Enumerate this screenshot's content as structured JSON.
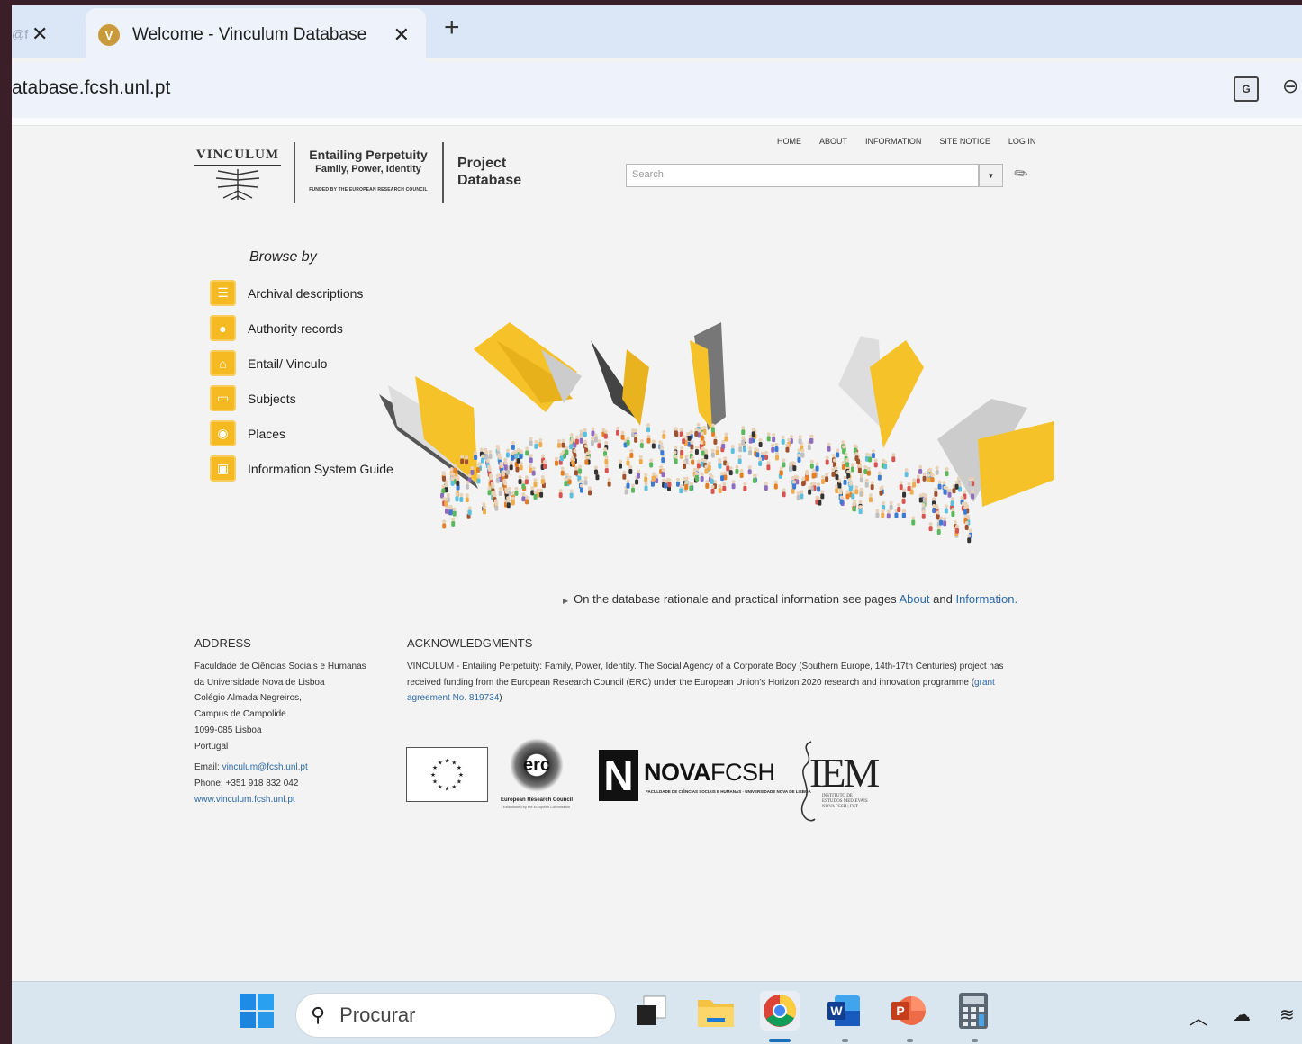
{
  "browser": {
    "prev_tab_fragment": "@f",
    "active_tab_title": "Welcome - Vinculum Database",
    "url": "atabase.fcsh.unl.pt"
  },
  "header": {
    "logo": {
      "vinculum": "VINCULUM",
      "entailing_line1": "Entailing Perpetuity",
      "entailing_line2": "Family, Power, Identity",
      "funded": "FUNDED BY THE EUROPEAN RESEARCH COUNCIL",
      "project_line1": "Project",
      "project_line2": "Database"
    },
    "nav": [
      "HOME",
      "ABOUT",
      "INFORMATION",
      "SITE NOTICE",
      "LOG IN"
    ],
    "search_placeholder": "Search"
  },
  "browse": {
    "title": "Browse by",
    "items": [
      {
        "label": "Archival descriptions",
        "icon": "document-icon"
      },
      {
        "label": "Authority records",
        "icon": "person-icon"
      },
      {
        "label": "Entail/ Vinculo",
        "icon": "building-icon"
      },
      {
        "label": "Subjects",
        "icon": "tag-icon"
      },
      {
        "label": "Places",
        "icon": "map-pin-icon"
      },
      {
        "label": "Information System Guide",
        "icon": "monitor-icon"
      }
    ]
  },
  "info": {
    "text": "On the database rationale and practical information see pages",
    "link_about": "About",
    "and": "and",
    "link_information": "Information."
  },
  "address": {
    "heading": "ADDRESS",
    "lines": [
      "Faculdade de Ciências Sociais e Humanas",
      "da Universidade Nova de Lisboa",
      "Colégio Almada Negreiros,",
      "Campus de Campolide",
      "1099-085 Lisboa",
      "Portugal"
    ],
    "email_label": "Email:",
    "email": "vinculum@fcsh.unl.pt",
    "phone": "Phone: +351 918 832 042",
    "website": "www.vinculum.fcsh.unl.pt"
  },
  "acknowledgments": {
    "heading": "ACKNOWLEDGMENTS",
    "text": "VINCULUM - Entailing Perpetuity: Family, Power, Identity. The Social Agency of a Corporate Body (Southern Europe, 14th-17th Centuries) project has received funding from the European Research Council (ERC) under the European Union's Horizon 2020 research and innovation programme (",
    "grant_link": "grant agreement No. 819734",
    "text_end": ")"
  },
  "sponsor_logos": {
    "erc": "erc",
    "erc_caption": "European Research Council",
    "erc_caption2": "Established by the European Commission",
    "nova_bold": "NOVA",
    "nova_light": "FCSH",
    "nova_sub": "FACULDADE DE CIÊNCIAS SOCIAIS E HUMANAS · UNIVERSIDADE NOVA DE LISBOA",
    "iem": "IEM",
    "iem_sub1": "INSTITUTO DE",
    "iem_sub2": "ESTUDOS MEDIEVAIS",
    "iem_sub3": "NOVA FCSH | FCT"
  },
  "taskbar": {
    "search_placeholder": "Procurar"
  },
  "colors": {
    "accent_yellow": "#f5b922",
    "link_blue": "#2d6aa8",
    "tabstrip": "#dbe6f7"
  }
}
